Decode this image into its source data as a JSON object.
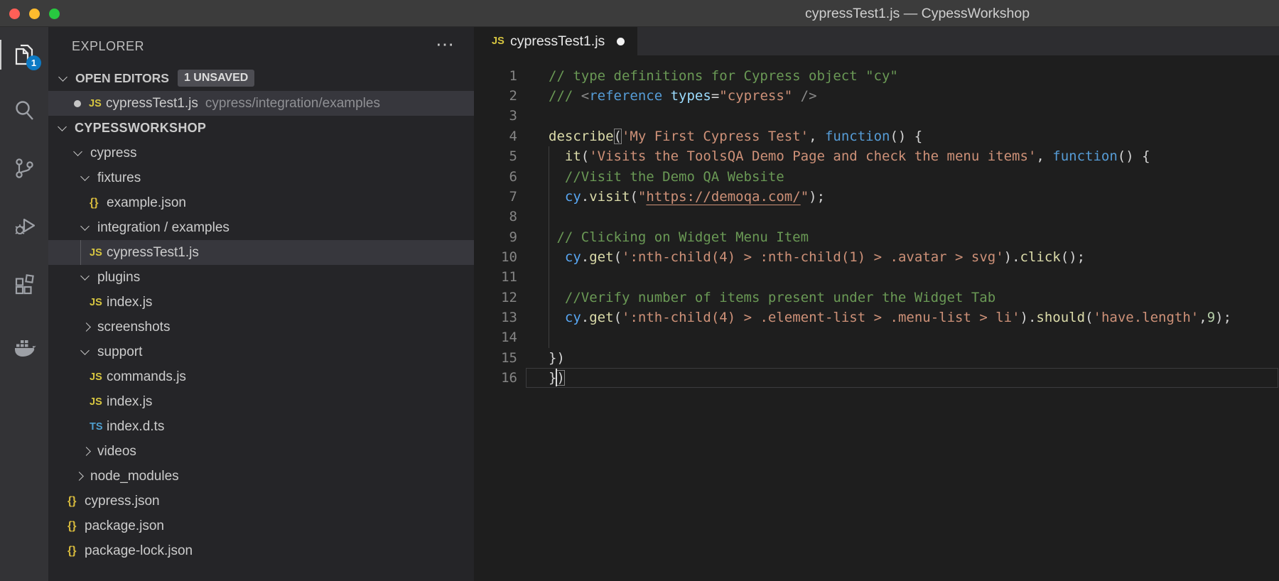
{
  "window": {
    "title": "cypressTest1.js — CypessWorkshop"
  },
  "colors": {
    "titlebar_bg": "#3c3c3c",
    "activitybar_bg": "#333336",
    "sidebar_bg": "#252528",
    "editor_bg": "#1e1e1e",
    "tabstrip_bg": "#2d2d30",
    "selection_bg": "#37373d",
    "badge_blue": "#0d7ac4",
    "traffic_red": "#ff5f57",
    "traffic_yellow": "#febc2e",
    "traffic_green": "#28c840",
    "comment": "#6a9955",
    "string": "#ce9178",
    "keyword": "#569cd6",
    "function": "#dcdcaa",
    "variable": "#58a6f2",
    "number": "#b5cea8",
    "js_icon": "#d6c540",
    "ts_icon": "#4f9fcf",
    "json_icon": "#d7ba3d"
  },
  "activity_bar": {
    "badge": "1",
    "items": [
      {
        "icon": "files-icon",
        "active": true
      },
      {
        "icon": "search-icon",
        "active": false
      },
      {
        "icon": "source-control-icon",
        "active": false
      },
      {
        "icon": "run-debug-icon",
        "active": false
      },
      {
        "icon": "extensions-icon",
        "active": false
      },
      {
        "icon": "docker-icon",
        "active": false
      }
    ]
  },
  "sidebar": {
    "header": "EXPLORER",
    "more_label": "⋯",
    "open_editors": {
      "label": "OPEN EDITORS",
      "badge": "1 UNSAVED",
      "items": [
        {
          "name": "cypressTest1.js",
          "path": "cypress/integration/examples",
          "modified": true,
          "file_icon": "js"
        }
      ]
    },
    "workspace": {
      "label": "CYPESSWORKSHOP"
    },
    "tree": [
      {
        "label": "cypress",
        "kind": "folder",
        "state": "open",
        "pad": 37
      },
      {
        "label": "fixtures",
        "kind": "folder",
        "state": "open",
        "pad": 47
      },
      {
        "label": "example.json",
        "kind": "file",
        "file_icon": "json",
        "pad": 58
      },
      {
        "label": "integration / examples",
        "kind": "folder",
        "state": "open",
        "pad": 47
      },
      {
        "label": "cypressTest1.js",
        "kind": "file",
        "file_icon": "js",
        "pad": 58,
        "selected": true,
        "guide": true
      },
      {
        "label": "plugins",
        "kind": "folder",
        "state": "open",
        "pad": 47
      },
      {
        "label": "index.js",
        "kind": "file",
        "file_icon": "js",
        "pad": 58
      },
      {
        "label": "screenshots",
        "kind": "folder",
        "state": "closed",
        "pad": 47
      },
      {
        "label": "support",
        "kind": "folder",
        "state": "open",
        "pad": 47
      },
      {
        "label": "commands.js",
        "kind": "file",
        "file_icon": "js",
        "pad": 58
      },
      {
        "label": "index.js",
        "kind": "file",
        "file_icon": "js",
        "pad": 58
      },
      {
        "label": "index.d.ts",
        "kind": "file",
        "file_icon": "ts",
        "pad": 58
      },
      {
        "label": "videos",
        "kind": "folder",
        "state": "closed",
        "pad": 47
      },
      {
        "label": "node_modules",
        "kind": "folder",
        "state": "closed",
        "pad": 37
      },
      {
        "label": "cypress.json",
        "kind": "file",
        "file_icon": "json",
        "pad": 27
      },
      {
        "label": "package.json",
        "kind": "file",
        "file_icon": "json",
        "pad": 27
      },
      {
        "label": "package-lock.json",
        "kind": "file",
        "file_icon": "json",
        "pad": 27
      }
    ]
  },
  "tabs": [
    {
      "label": "cypressTest1.js",
      "file_icon": "js",
      "modified": true,
      "active": true
    }
  ],
  "editor": {
    "lines": [
      {
        "num": "1",
        "tokens": [
          [
            "cm",
            "// type definitions for Cypress object \"cy\""
          ]
        ]
      },
      {
        "num": "2",
        "tokens": [
          [
            "cm",
            "/// "
          ],
          [
            "gy",
            "<"
          ],
          [
            "kw",
            "reference"
          ],
          [
            "at",
            " types"
          ],
          [
            "pn",
            "="
          ],
          [
            "st",
            "\"cypress\""
          ],
          [
            "gy",
            " />"
          ]
        ]
      },
      {
        "num": "3",
        "tokens": []
      },
      {
        "num": "4",
        "tokens": [
          [
            "fn",
            "describe"
          ],
          [
            "pn bm",
            "("
          ],
          [
            "st",
            "'My First Cypress Test'"
          ],
          [
            "pn",
            ", "
          ],
          [
            "kw",
            "function"
          ],
          [
            "pn",
            "() {"
          ]
        ]
      },
      {
        "num": "5",
        "tokens": [
          [
            "pn",
            "  "
          ],
          [
            "fn",
            "it"
          ],
          [
            "pn",
            "("
          ],
          [
            "st",
            "'Visits the ToolsQA Demo Page and check the menu items'"
          ],
          [
            "pn",
            ", "
          ],
          [
            "kw",
            "function"
          ],
          [
            "pn",
            "() {"
          ]
        ]
      },
      {
        "num": "6",
        "tokens": [
          [
            "pn",
            "  "
          ],
          [
            "cm",
            "//Visit the Demo QA Website"
          ]
        ]
      },
      {
        "num": "7",
        "tokens": [
          [
            "pn",
            "  "
          ],
          [
            "vr",
            "cy"
          ],
          [
            "pn",
            "."
          ],
          [
            "fn",
            "visit"
          ],
          [
            "pn",
            "("
          ],
          [
            "st",
            "\""
          ],
          [
            "st u",
            "https://demoqa.com/"
          ],
          [
            "st",
            "\""
          ],
          [
            "pn",
            ");"
          ]
        ]
      },
      {
        "num": "8",
        "tokens": []
      },
      {
        "num": "9",
        "tokens": [
          [
            "pn",
            " "
          ],
          [
            "cm",
            "// Clicking on Widget Menu Item"
          ]
        ]
      },
      {
        "num": "10",
        "tokens": [
          [
            "pn",
            "  "
          ],
          [
            "vr",
            "cy"
          ],
          [
            "pn",
            "."
          ],
          [
            "fn",
            "get"
          ],
          [
            "pn",
            "("
          ],
          [
            "st",
            "':nth-child(4) > :nth-child(1) > .avatar > svg'"
          ],
          [
            "pn",
            ")."
          ],
          [
            "fn",
            "click"
          ],
          [
            "pn",
            "();"
          ]
        ]
      },
      {
        "num": "11",
        "tokens": []
      },
      {
        "num": "12",
        "tokens": [
          [
            "pn",
            "  "
          ],
          [
            "cm",
            "//Verify number of items present under the Widget Tab"
          ]
        ]
      },
      {
        "num": "13",
        "tokens": [
          [
            "pn",
            "  "
          ],
          [
            "vr",
            "cy"
          ],
          [
            "pn",
            "."
          ],
          [
            "fn",
            "get"
          ],
          [
            "pn",
            "("
          ],
          [
            "st",
            "':nth-child(4) > .element-list > .menu-list > li'"
          ],
          [
            "pn",
            ")."
          ],
          [
            "fn",
            "should"
          ],
          [
            "pn",
            "("
          ],
          [
            "st",
            "'have.length'"
          ],
          [
            "pn",
            ","
          ],
          [
            "num",
            "9"
          ],
          [
            "pn",
            ");"
          ]
        ]
      },
      {
        "num": "14",
        "tokens": []
      },
      {
        "num": "15",
        "tokens": [
          [
            "pn",
            "})"
          ]
        ]
      },
      {
        "num": "16",
        "tokens": [
          [
            "pn",
            "}"
          ],
          [
            "pn bm",
            ")"
          ]
        ]
      }
    ]
  }
}
